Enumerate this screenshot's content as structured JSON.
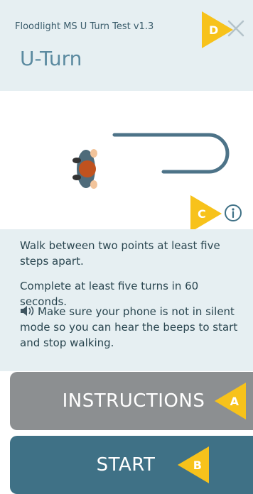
{
  "header": {
    "app_title": "Floodlight MS U Turn Test v1.3",
    "page_title": "U-Turn"
  },
  "illustration": {
    "description_icons": [
      "walking-person-icon",
      "u-turn-path-icon"
    ]
  },
  "description": {
    "line1": "Walk between two points at least five steps apart.",
    "line2": "Complete at least five turns in 60 seconds.",
    "line3": "Make sure your phone is not in silent mode so you can hear the beeps to start and stop walking."
  },
  "buttons": {
    "instructions_label": "INSTRUCTIONS",
    "start_label": "START"
  },
  "markers": {
    "a": "A",
    "b": "B",
    "c": "C",
    "d": "D"
  },
  "colors": {
    "header_bg": "#e6eff2",
    "title": "#5b8aa0",
    "instructions_btn": "#8c8f91",
    "start_btn": "#3f7186",
    "marker": "#f7c21b"
  }
}
